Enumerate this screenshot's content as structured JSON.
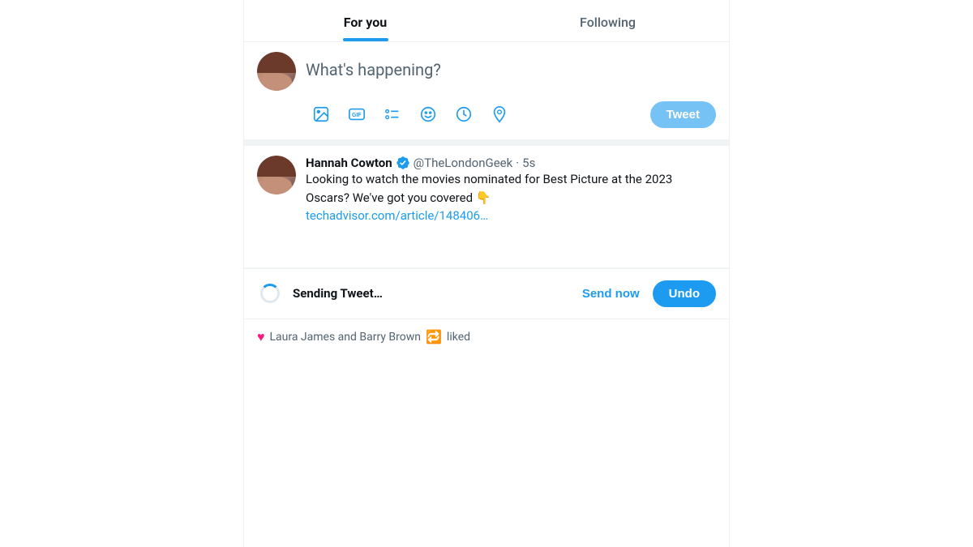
{
  "tabs": {
    "for_you": "For you",
    "following": "Following"
  },
  "compose": {
    "placeholder": "What's happening?",
    "tweet_button": "Tweet"
  },
  "tweet": {
    "author_name": "Hannah Cowton",
    "author_handle": "@TheLondonGeek",
    "time": "5s",
    "body_text": "Looking to watch the movies nominated for Best Picture at the 2023 Oscars? We've got you covered 👇",
    "link": "techadvisor.com/article/148406…",
    "emoji": "👇"
  },
  "sending": {
    "text": "Sending Tweet…",
    "send_now": "Send now",
    "undo": "Undo"
  },
  "bottom": {
    "text": "liked"
  },
  "icons": {
    "image": "image-icon",
    "gif": "gif-icon",
    "list": "list-icon",
    "emoji": "emoji-icon",
    "schedule": "schedule-icon",
    "location": "location-icon"
  },
  "colors": {
    "accent": "#1d9bf0",
    "text_secondary": "#536471",
    "border": "#eff3f4"
  }
}
